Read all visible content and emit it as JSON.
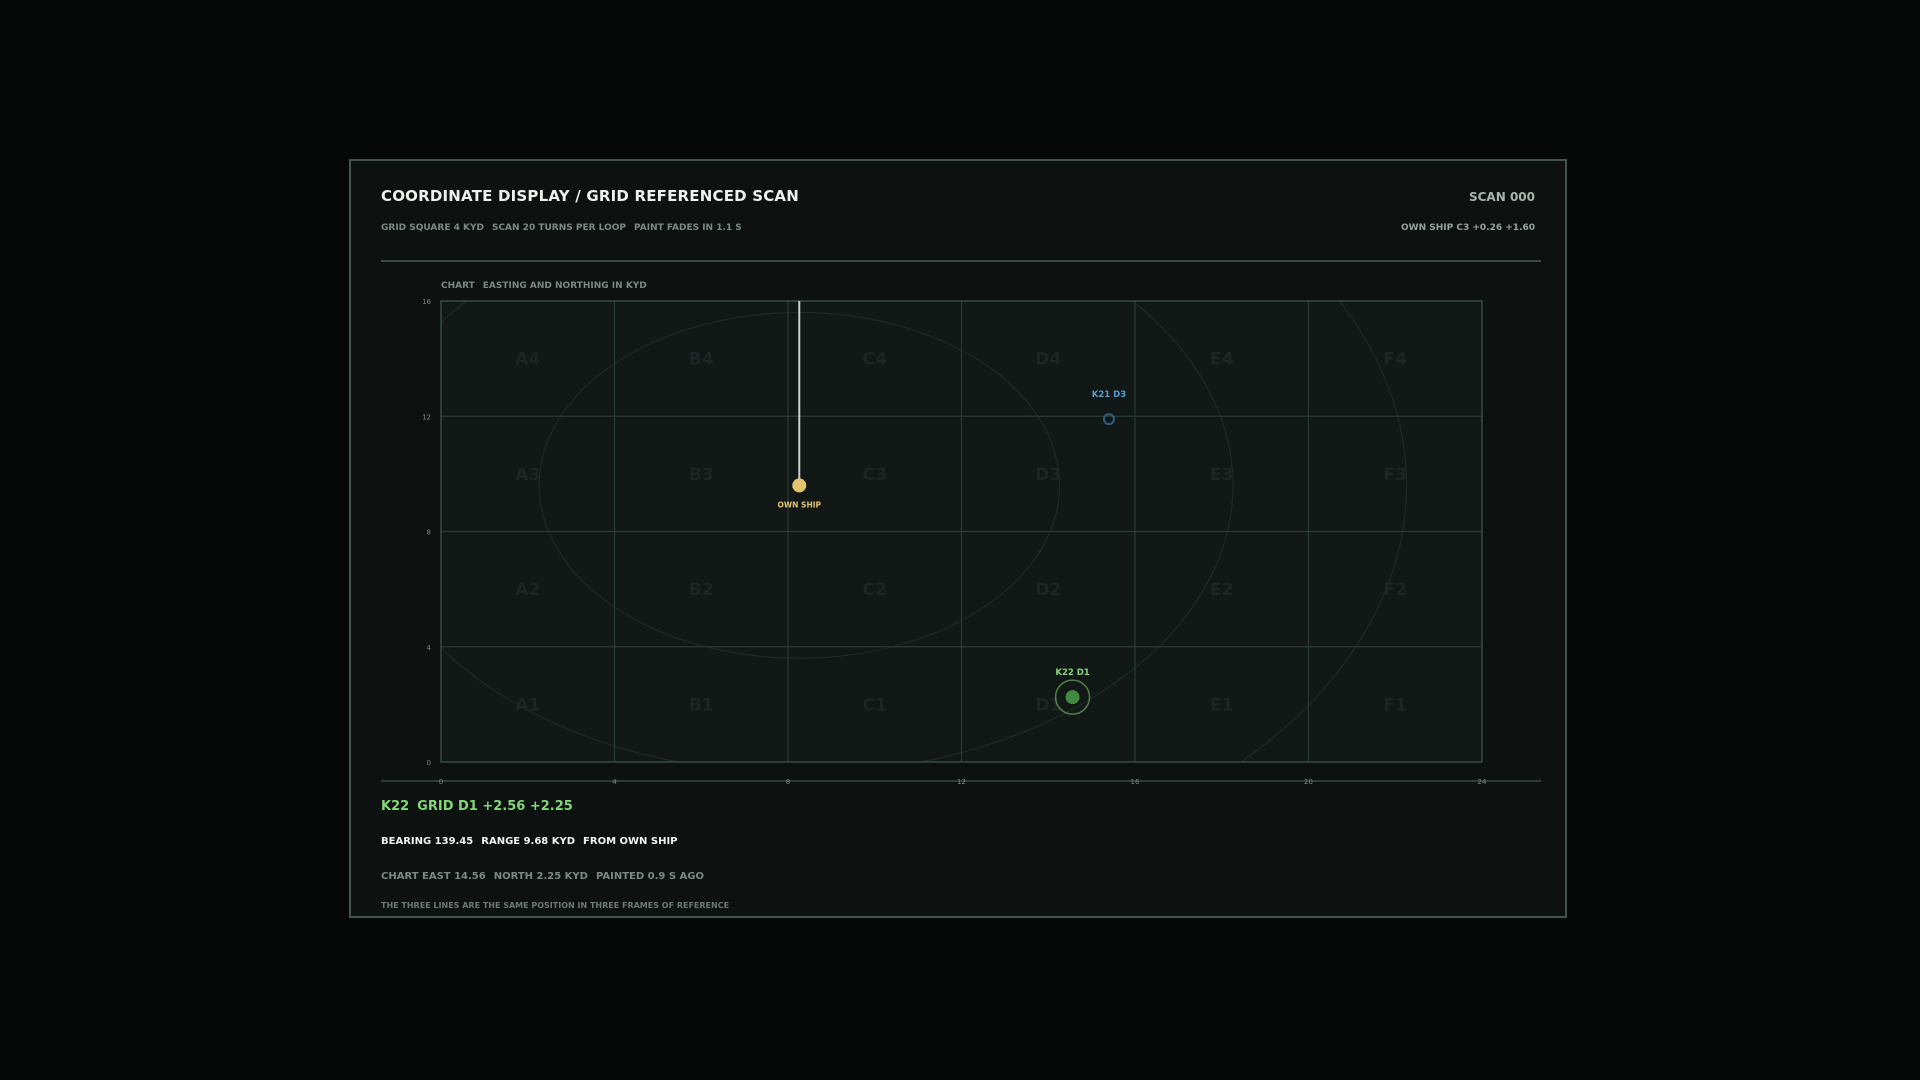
{
  "header": {
    "title": "COORDINATE DISPLAY / GRID REFERENCED SCAN",
    "scan_counter": "SCAN 000",
    "subtitle_parts": [
      "GRID SQUARE 4 KYD",
      "SCAN 20 TURNS PER LOOP",
      "PAINT FADES IN 1.1 S"
    ],
    "own_ship_readout": "OWN SHIP C3 +0.26 +1.60"
  },
  "chart": {
    "label_parts": [
      "CHART",
      "EASTING AND NORTHING IN KYD"
    ],
    "x_ticks": [
      0,
      4,
      8,
      12,
      16,
      20,
      24
    ],
    "y_ticks": [
      0,
      4,
      8,
      12,
      16
    ],
    "xlim": [
      0,
      24
    ],
    "ylim": [
      0,
      16
    ],
    "grid_columns": [
      "A",
      "B",
      "C",
      "D",
      "E",
      "F"
    ],
    "grid_rows": [
      "1",
      "2",
      "3",
      "4"
    ],
    "own_ship": {
      "label": "OWN SHIP",
      "east": 8.26,
      "north": 9.6,
      "color": "#e3c46e"
    },
    "range_rings_kyd": [
      6,
      10,
      14
    ],
    "sweep_bearing_deg": 0,
    "contacts": [
      {
        "id": "K22",
        "label": "K22 D1",
        "east": 14.56,
        "north": 2.25,
        "color": "#86d47c",
        "selected": true,
        "painted": true
      },
      {
        "id": "K21",
        "label": "K21 D3",
        "east": 15.4,
        "north": 11.9,
        "color": "#5b9ccf",
        "selected": false,
        "painted": false
      }
    ],
    "colors": {
      "grid": "#2a3a36",
      "ring": "#1f2a27",
      "cell_label": "#1d2624",
      "tick": "#7d8783"
    }
  },
  "readout": {
    "contact_id": "K22",
    "grid_ref": "GRID D1 +2.56 +2.25",
    "bearing_parts": [
      "BEARING 139.45",
      "RANGE 9.68 KYD",
      "FROM OWN SHIP"
    ],
    "chart_parts": [
      "CHART EAST 14.56",
      "NORTH 2.25 KYD",
      "PAINTED 0.9 S AGO"
    ],
    "footnote": "THE THREE LINES ARE THE SAME POSITION IN THREE FRAMES OF REFERENCE"
  }
}
